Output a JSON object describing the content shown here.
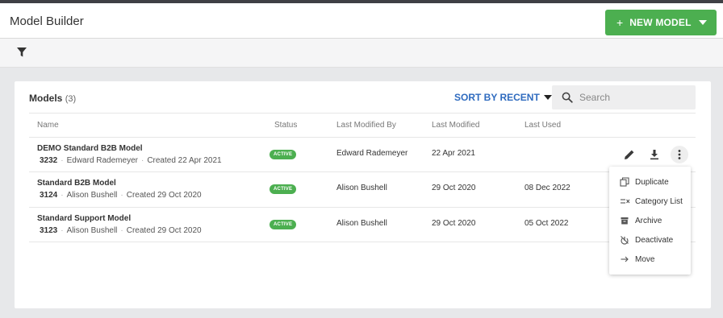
{
  "header": {
    "title": "Model Builder",
    "new_model_plus": "+",
    "new_model_label": "NEW MODEL"
  },
  "toolbar": {
    "filter_icon": "filter-icon"
  },
  "models": {
    "title": "Models",
    "count": "(3)",
    "sort_label": "SORT BY RECENT",
    "search_placeholder": "Search",
    "columns": [
      "Name",
      "Status",
      "Last Modified By",
      "Last Modified",
      "Last Used"
    ],
    "rows": [
      {
        "name": "DEMO Standard B2B Model",
        "id": "3232",
        "creator": "Edward Rademeyer",
        "created": "Created 22 Apr 2021",
        "status": "ACTIVE",
        "modified_by": "Edward Rademeyer",
        "modified": "22 Apr 2021",
        "last_used": ""
      },
      {
        "name": "Standard B2B Model",
        "id": "3124",
        "creator": "Alison Bushell",
        "created": "Created 29 Oct 2020",
        "status": "ACTIVE",
        "modified_by": "Alison Bushell",
        "modified": "29 Oct 2020",
        "last_used": "08 Dec 2022"
      },
      {
        "name": "Standard Support Model",
        "id": "3123",
        "creator": "Alison Bushell",
        "created": "Created 29 Oct 2020",
        "status": "ACTIVE",
        "modified_by": "Alison Bushell",
        "modified": "29 Oct 2020",
        "last_used": "05 Oct 2022"
      }
    ],
    "separator": "·"
  },
  "context_menu": {
    "items": [
      {
        "label": "Duplicate",
        "icon": "duplicate-icon"
      },
      {
        "label": "Category List",
        "icon": "category-list-icon"
      },
      {
        "label": "Archive",
        "icon": "archive-icon"
      },
      {
        "label": "Deactivate",
        "icon": "deactivate-icon"
      },
      {
        "label": "Move",
        "icon": "arrow-right-icon"
      }
    ]
  },
  "colors": {
    "accent_green": "#4caf50",
    "link_blue": "#2f6bbf",
    "background": "#e7e8ea"
  }
}
